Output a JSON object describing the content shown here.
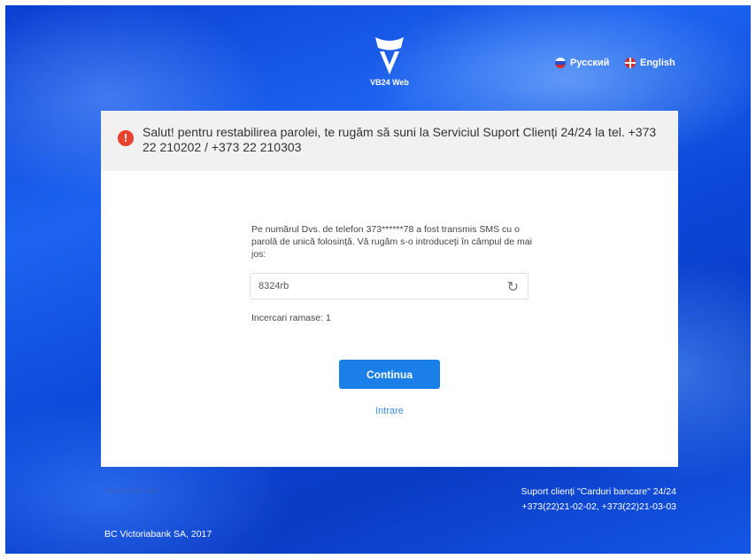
{
  "brand": {
    "name": "VB24 Web"
  },
  "languages": [
    {
      "label": "Русский",
      "flag": "ru-flag-icon"
    },
    {
      "label": "English",
      "flag": "uk-flag-icon"
    }
  ],
  "alert": {
    "icon": "exclamation-icon",
    "message": "Salut! pentru restabilirea parolei, te rugăm să suni la Serviciul Suport Clienți 24/24 la tel. +373 22 210202 / +373 22 210303"
  },
  "form": {
    "info": "Pe numărul Dvs. de telefon 373******78 a fost transmis SMS cu o parolă de unică folosință. Vă rugăm s-o introduceți în câmpul de mai jos:",
    "otp_value": "8324rb",
    "refresh_icon": "refresh-icon",
    "attempts": "Incercari ramase: 1",
    "continue_label": "Continua",
    "login_link": "Intrare"
  },
  "footer": {
    "useful_info": "Informatii utile",
    "support_title": "Suport clienți \"Carduri bancare\" 24/24",
    "support_phones": "+373(22)21-02-02, +373(22)21-03-03",
    "copyright": "BC Victoriabank SA, 2017"
  },
  "colors": {
    "accent": "#1a7fe6",
    "alert": "#e8412d",
    "background": "#0b46d6"
  }
}
